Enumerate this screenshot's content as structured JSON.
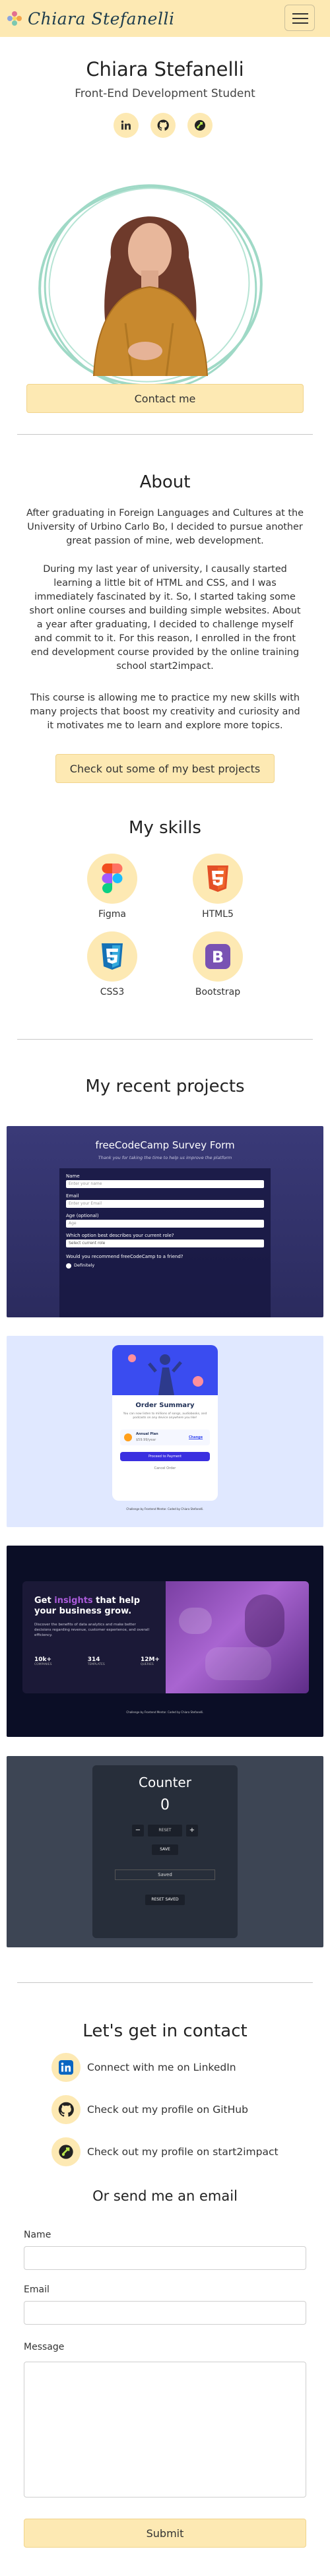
{
  "navbar": {
    "brand": "Chiara Stefanelli",
    "toggle_icon": "hamburger-icon"
  },
  "hero": {
    "name": "Chiara Stefanelli",
    "subtitle": "Front-End Development Student",
    "socials": [
      {
        "icon": "linkedin-icon"
      },
      {
        "icon": "github-icon"
      },
      {
        "icon": "start2impact-icon"
      }
    ],
    "contact_button": "Contact me"
  },
  "about": {
    "title": "About",
    "p1": "After graduating in Foreign Languages and Cultures at the University of Urbino Carlo Bo, I decided to pursue another great passion of mine, web development.",
    "p2": "During my last year of university, I causally started learning a little bit of HTML and CSS, and I was immediately fascinated by it. So, I started taking some short online courses and building simple websites. About a year after graduating, I decided to challenge myself and commit to it. For this reason, I enrolled in the front end development course provided by the online training school start2impact.",
    "p3": "This course is allowing me to practice my new skills with many projects that boost my creativity and curiosity and it motivates me to learn and explore more topics.",
    "projects_button": "Check out some of my best projects"
  },
  "skills": {
    "title": "My skills",
    "items": [
      {
        "label": "Figma",
        "icon": "figma-icon"
      },
      {
        "label": "HTML5",
        "icon": "html5-icon"
      },
      {
        "label": "CSS3",
        "icon": "css3-icon"
      },
      {
        "label": "Bootstrap",
        "icon": "bootstrap-icon"
      }
    ]
  },
  "projects": {
    "title": "My recent projects",
    "survey": {
      "title": "freeCodeCamp Survey Form",
      "subtitle": "Thank you for taking the time to help us improve the platform",
      "fields": [
        {
          "label": "Name",
          "placeholder": "Enter your name"
        },
        {
          "label": "Email",
          "placeholder": "Enter your Email"
        },
        {
          "label": "Age (optional)",
          "placeholder": "Age"
        }
      ],
      "select_label": "Which option best describes your current role?",
      "select_value": "Select current role",
      "question": "Would you recommend freeCodeCamp to a friend?",
      "radio_value": "Definitely"
    },
    "order": {
      "title": "Order Summary",
      "text": "You can now listen to millions of songs, audiobooks, and podcasts on any device anywhere you like!",
      "plan_name": "Annual Plan",
      "plan_price": "$59.99/year",
      "change": "Change",
      "pay_button": "Proceed to Payment",
      "cancel_button": "Cancel Order",
      "footer": "Challenge by Frontend Mentor. Coded by Chiara Stefanelli."
    },
    "stats": {
      "heading_pre": "Get ",
      "heading_accent": "insights",
      "heading_post": " that help your business grow.",
      "text": "Discover the benefits of data analytics and make better decisions regarding revenue, customer experience, and overall efficiency.",
      "stats": [
        {
          "value": "10k+",
          "label": "COMPANIES"
        },
        {
          "value": "314",
          "label": "TEMPLATES"
        },
        {
          "value": "12M+",
          "label": "QUERIES"
        }
      ],
      "footer": "Challenge by Frontend Mentor. Coded by Chiara Stefanelli."
    },
    "counter": {
      "title": "Counter",
      "value": "0",
      "minus": "−",
      "input": "RESET",
      "plus": "+",
      "save": "SAVE",
      "saved": "Saved",
      "reset_all": "RESET SAVED"
    }
  },
  "contact": {
    "title": "Let's get in contact",
    "links": [
      {
        "text": "Connect with me on LinkedIn",
        "icon": "linkedin-icon"
      },
      {
        "text": "Check out my profile on GitHub",
        "icon": "github-icon"
      },
      {
        "text": "Check out my profile on start2impact",
        "icon": "start2impact-icon"
      }
    ],
    "email_title": "Or send me an email",
    "name_label": "Name",
    "email_label": "Email",
    "message_label": "Message",
    "submit": "Submit"
  },
  "colors": {
    "accent": "#fde9b3",
    "text": "#222222",
    "teal": "#9fd9c6"
  }
}
